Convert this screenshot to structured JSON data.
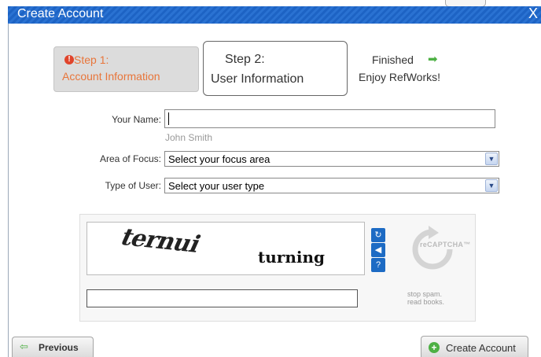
{
  "window": {
    "title": "Create Account",
    "close_label": "X"
  },
  "steps": {
    "step1": {
      "line1": "Step 1:",
      "line2": "Account Information"
    },
    "step2": {
      "line1": "Step 2:",
      "line2": "User Information"
    },
    "finished": {
      "line1": "Finished",
      "line2": "Enjoy RefWorks!"
    }
  },
  "form": {
    "name_label": "Your Name:",
    "name_value": "",
    "name_hint": "John Smith",
    "focus_label": "Area of Focus:",
    "focus_value": "Select your focus area",
    "type_label": "Type of User:",
    "type_value": "Select your user type"
  },
  "captcha": {
    "word1": "ternui",
    "word2": "turning",
    "logo_text": "reCAPTCHA™",
    "slogan_line1": "stop spam.",
    "slogan_line2": "read books.",
    "response_value": ""
  },
  "buttons": {
    "previous": "Previous",
    "create": "Create Account"
  },
  "colors": {
    "title_bar": "#1d63c4",
    "active_step": "#e8753a",
    "accent_green": "#4db044",
    "captcha_button": "#1d6bc4"
  },
  "icons": {
    "alert": "alert-circle-icon",
    "finished_arrow": "arrow-right-icon",
    "dropdown": "chevron-down-icon",
    "refresh": "refresh-icon",
    "audio": "audio-icon",
    "help": "help-icon",
    "previous": "arrow-left-icon",
    "create": "plus-circle-icon"
  }
}
